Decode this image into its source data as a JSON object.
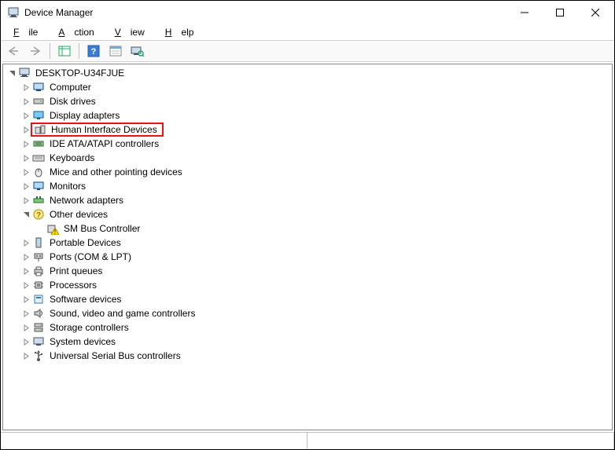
{
  "window": {
    "title": "Device Manager"
  },
  "menu": {
    "file": "File",
    "action": "Action",
    "view": "View",
    "help": "Help"
  },
  "tree": {
    "root": "DESKTOP-U34FJUE",
    "items": [
      {
        "label": "Computer",
        "icon": "computer"
      },
      {
        "label": "Disk drives",
        "icon": "disk"
      },
      {
        "label": "Display adapters",
        "icon": "display"
      },
      {
        "label": "Human Interface Devices",
        "icon": "hid",
        "highlight": true
      },
      {
        "label": "IDE ATA/ATAPI controllers",
        "icon": "ide"
      },
      {
        "label": "Keyboards",
        "icon": "keyboard"
      },
      {
        "label": "Mice and other pointing devices",
        "icon": "mouse"
      },
      {
        "label": "Monitors",
        "icon": "monitor"
      },
      {
        "label": "Network adapters",
        "icon": "network"
      },
      {
        "label": "Other devices",
        "icon": "other",
        "expanded": true,
        "children": [
          {
            "label": "SM Bus Controller",
            "icon": "warn"
          }
        ]
      },
      {
        "label": "Portable Devices",
        "icon": "portable"
      },
      {
        "label": "Ports (COM & LPT)",
        "icon": "ports"
      },
      {
        "label": "Print queues",
        "icon": "print"
      },
      {
        "label": "Processors",
        "icon": "cpu"
      },
      {
        "label": "Software devices",
        "icon": "software"
      },
      {
        "label": "Sound, video and game controllers",
        "icon": "sound"
      },
      {
        "label": "Storage controllers",
        "icon": "storage"
      },
      {
        "label": "System devices",
        "icon": "system"
      },
      {
        "label": "Universal Serial Bus controllers",
        "icon": "usb"
      }
    ]
  }
}
